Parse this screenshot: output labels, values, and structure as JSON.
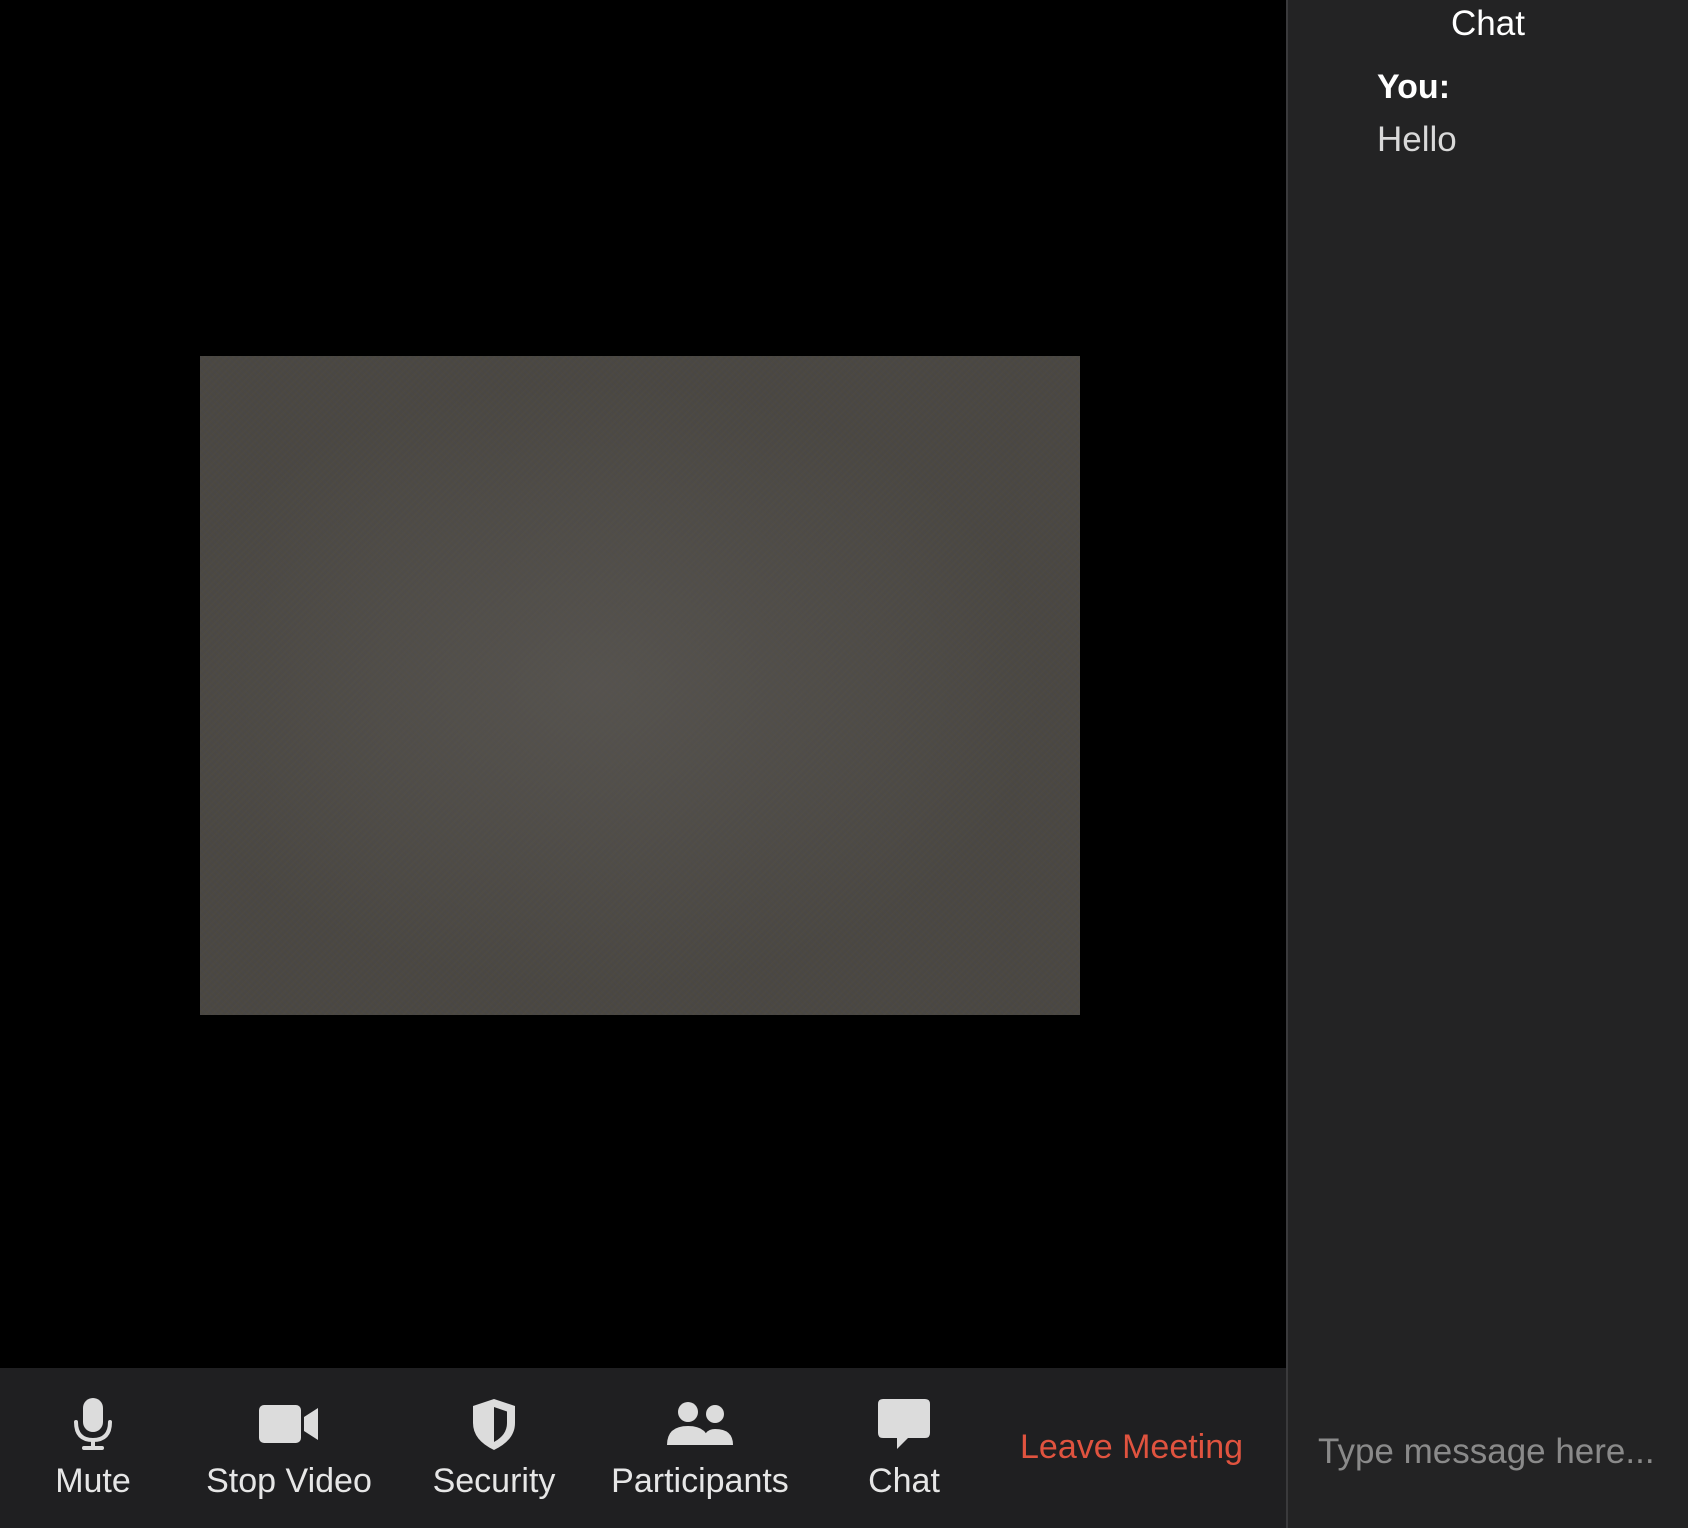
{
  "toolbar": {
    "mute_label": "Mute",
    "stop_video_label": "Stop Video",
    "security_label": "Security",
    "participants_label": "Participants",
    "chat_label": "Chat",
    "leave_label": "Leave Meeting",
    "icons": {
      "mute": "microphone-icon",
      "stop_video": "video-camera-icon",
      "security": "shield-icon",
      "participants": "participants-icon",
      "chat": "chat-bubble-icon"
    }
  },
  "chat": {
    "title": "Chat",
    "messages": [
      {
        "sender": "You:",
        "text": "Hello"
      }
    ],
    "input_placeholder": "Type message here..."
  },
  "colors": {
    "leave": "#e0533f",
    "toolbar_bg": "#1f1f21",
    "panel_bg": "#232324",
    "video_bg": "#000000"
  }
}
